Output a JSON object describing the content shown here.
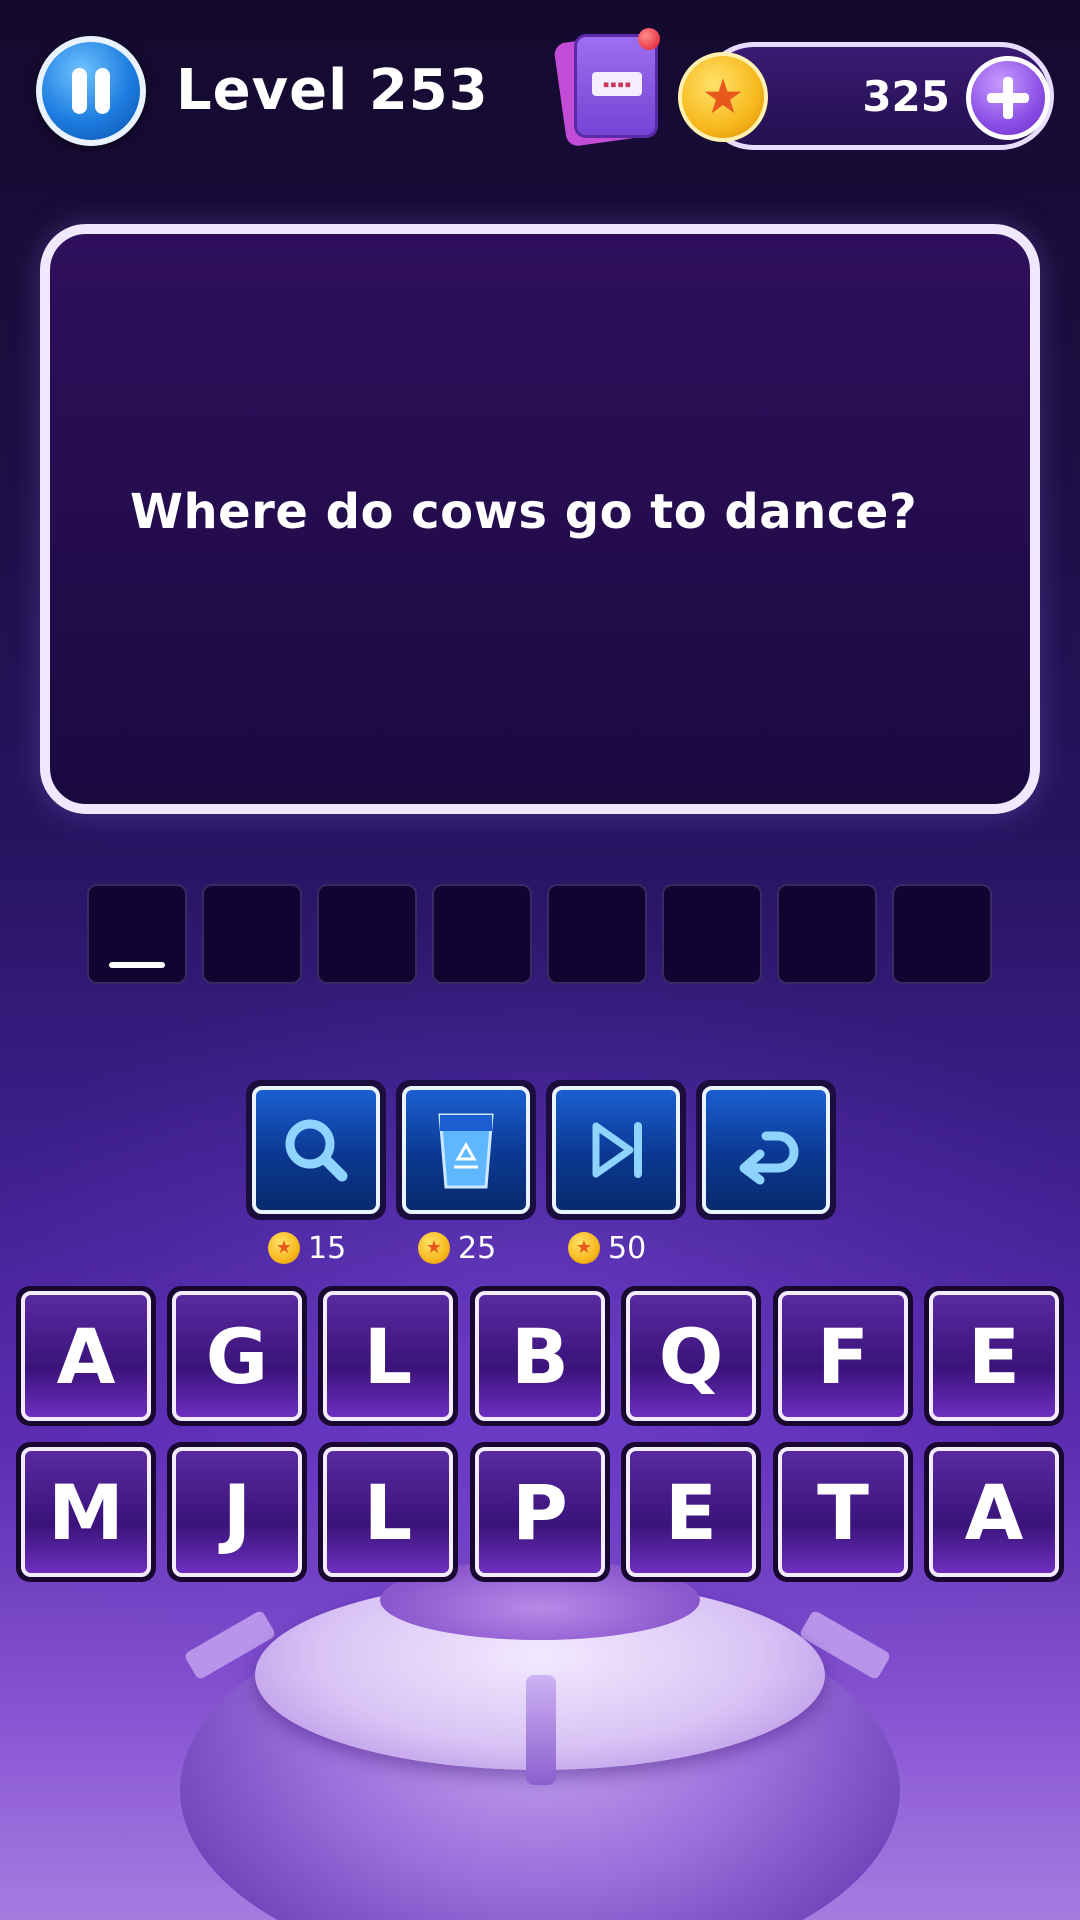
{
  "header": {
    "level_label": "Level 253",
    "coins": "325"
  },
  "question": {
    "text": "Where do cows go to dance?"
  },
  "answer": {
    "slot_count": 8,
    "slots": [
      "",
      "",
      "",
      "",
      "",
      "",
      "",
      ""
    ]
  },
  "powerups": [
    {
      "name": "reveal",
      "icon": "magnifier-icon",
      "cost": "15"
    },
    {
      "name": "remove",
      "icon": "recycle-bin-icon",
      "cost": "25"
    },
    {
      "name": "skip",
      "icon": "skip-icon",
      "cost": "50"
    },
    {
      "name": "undo",
      "icon": "undo-arrow-icon"
    }
  ],
  "keyboard": {
    "row1": [
      "A",
      "G",
      "L",
      "B",
      "Q",
      "F",
      "E"
    ],
    "row2": [
      "M",
      "J",
      "L",
      "P",
      "E",
      "T",
      "A"
    ]
  },
  "colors": {
    "accent_purple": "#6e2fc0",
    "powerup_blue": "#1b5ed1",
    "coin_gold": "#f7b81d",
    "background_top": "#140a2e"
  }
}
